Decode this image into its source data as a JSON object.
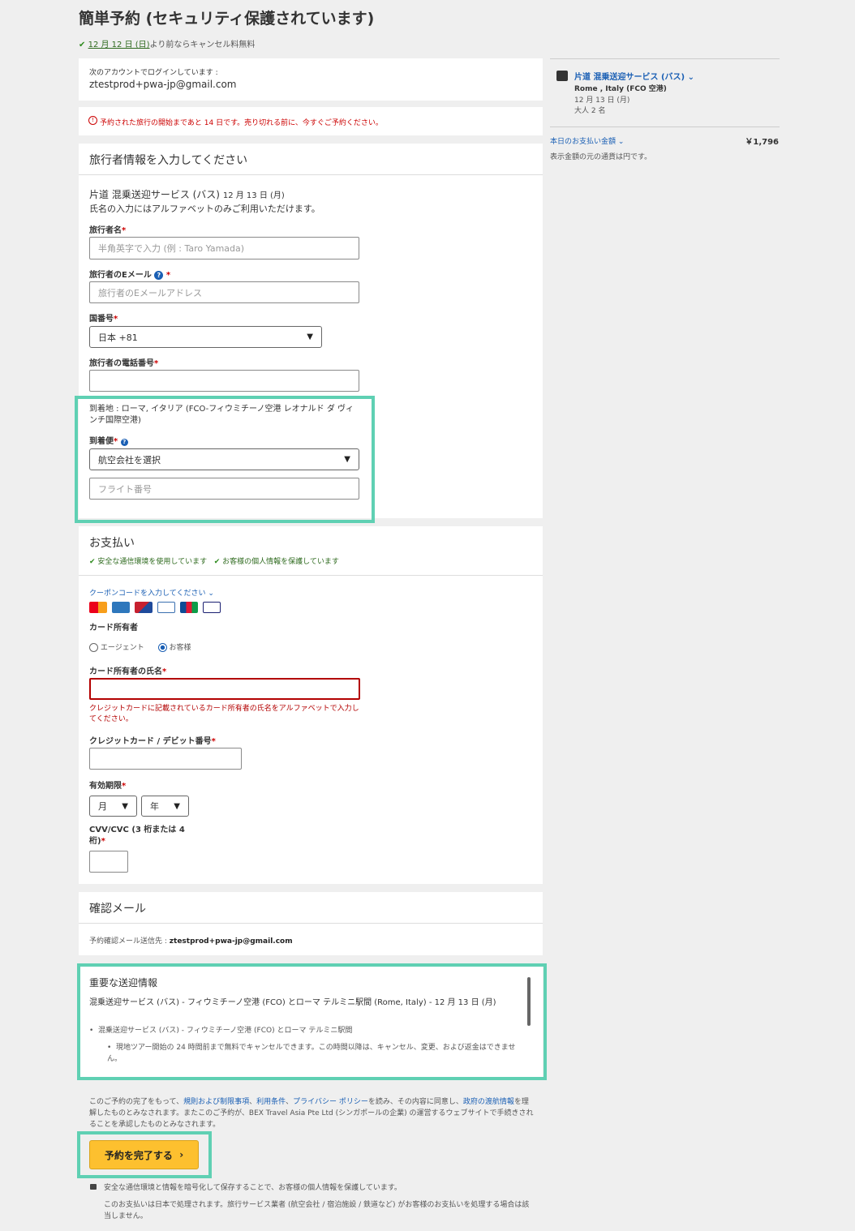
{
  "header": {
    "title": "簡単予約 (セキュリティ保護されています)",
    "cancel_date": "12 月 12 日 (日)",
    "cancel_note": "より前ならキャンセル料無料"
  },
  "account": {
    "label": "次のアカウントでログインしています :",
    "email": "ztestprod+pwa-jp@gmail.com"
  },
  "alert": {
    "text": "予約された旅行の開始まであと 14 日です。売り切れる前に、今すぐご予約ください。"
  },
  "traveler": {
    "section_title": "旅行者情報を入力してください",
    "product_title": "片道 混乗送迎サービス (バス)",
    "product_date": "12 月 13 日 (月)",
    "name_note": "氏名の入力にはアルファベットのみご利用いただけます。",
    "name_label": "旅行者名",
    "name_placeholder": "半角英字で入力 (例 : Taro Yamada)",
    "email_label": "旅行者のEメール",
    "email_placeholder": "旅行者のEメールアドレス",
    "country_label": "国番号",
    "country_value": "日本 +81",
    "phone_label": "旅行者の電話番号",
    "arrival_text": "到着地 : ローマ, イタリア (FCO-フィウミチーノ空港 レオナルド ダ ヴィンチ国際空港)",
    "flight_label": "到着便",
    "airline_value": "航空会社を選択",
    "flight_placeholder": "フライト番号"
  },
  "payment": {
    "title": "お支払い",
    "secure1": "安全な通信環境を使用しています",
    "secure2": "お客様の個人情報を保護しています",
    "coupon": "クーポンコードを入力してください",
    "cardholder_label": "カード所有者",
    "radio_agent": "エージェント",
    "radio_customer": "お客様",
    "holder_name_label": "カード所有者の氏名",
    "holder_error": "クレジットカードに記載されているカード所有者の氏名をアルファベットで入力してください。",
    "card_number_label": "クレジットカード / デビット番号",
    "expiry_label": "有効期限",
    "month": "月",
    "year": "年",
    "cvv_label": "CVV/CVC (3 桁または 4 桁)"
  },
  "confirm": {
    "title": "確認メール",
    "prefix": "予約確認メール送信先 :",
    "email": "ztestprod+pwa-jp@gmail.com"
  },
  "transfer": {
    "title": "重要な送迎情報",
    "heading": "混乗送迎サービス (バス) - フィウミチーノ空港 (FCO) とローマ テルミニ駅間 (Rome, Italy) - 12 月 13 日 (月)",
    "item": "混乗送迎サービス (バス) - フィウミチーノ空港 (FCO) とローマ テルミニ駅間",
    "subitem": "現地ツアー開始の 24 時間前まで無料でキャンセルできます。この時間以降は、キャンセル、変更、および返金はできません。"
  },
  "terms": {
    "t1": "このご予約の完了をもって、",
    "link1": "規則および制限事項",
    "t2": "、",
    "link2": "利用条件",
    "t3": "、",
    "link3": "プライバシー ポリシー",
    "t4": "を読み、その内容に同意し、",
    "link4": "政府の渡航情報",
    "t5": "を理解したものとみなされます。またこのご予約が、BEX Travel Asia Pte Ltd (シンガポールの企業) の運営するウェブサイトで手続きされることを承認したものとみなされます。"
  },
  "submit": {
    "label": "予約を完了する"
  },
  "footer": {
    "secure": "安全な通信環境と情報を暗号化して保存することで、お客様の個人情報を保護しています。",
    "process": "このお支払いは日本で処理されます。旅行サービス業者 (航空会社 / 宿泊施設 / 鉄道など) がお客様のお支払いを処理する場合は該当しません。"
  },
  "summary": {
    "title": "片道 混乗送迎サービス (バス)",
    "location": "Rome , Italy (FCO 空港)",
    "date": "12 月 13 日 (月)",
    "guests": "大人 2 名",
    "pay_label": "本日のお支払い金額",
    "amount": "￥1,796",
    "currency_note": "表示金額の元の通貨は円です。"
  },
  "colors": {
    "accent": "#5fd0b3",
    "button": "#fdc02f",
    "error": "#b30000",
    "link": "#1a5fb4"
  }
}
